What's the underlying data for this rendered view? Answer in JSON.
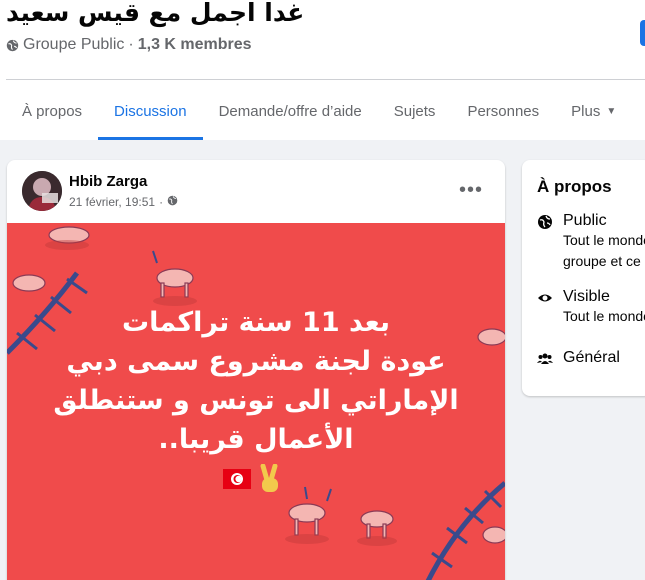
{
  "group": {
    "title": "غدا اجمل مع قيس سعيد",
    "privacy": "Groupe Public",
    "separator": "·",
    "members": "1,3 K membres"
  },
  "tabs": [
    {
      "label": "À propos"
    },
    {
      "label": "Discussion"
    },
    {
      "label": "Demande/offre d’aide"
    },
    {
      "label": "Sujets"
    },
    {
      "label": "Personnes"
    },
    {
      "label": "Plus"
    }
  ],
  "post": {
    "author": "Hbib Zarga",
    "date": "21 février, 19:51",
    "dot": "·",
    "image_text": [
      "بعد 11 سنة تراكمات",
      "عودة لجنة مشروع سمى دبي",
      "الإماراتي الى تونس و ستنطلق",
      "الأعمال قريبا.."
    ],
    "more_label": "•••"
  },
  "about": {
    "title": "À propos",
    "public_label": "Public",
    "public_desc": [
      "Tout le monde peut voir qui est dans le",
      "groupe et ce qui est publié."
    ],
    "visible_label": "Visible",
    "visible_desc": "Tout le monde peut trouver ce groupe.",
    "general_label": "Général"
  },
  "colors": {
    "accent": "#1b74e4",
    "post_bg": "#f04b4b"
  }
}
